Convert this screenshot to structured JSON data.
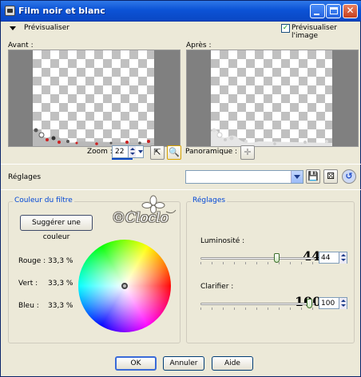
{
  "window": {
    "title": "Film noir et blanc"
  },
  "preview": {
    "toggle_label": "Prévisualiser",
    "show_image_label": "Prévisualiser l'image",
    "show_image_checked": true,
    "before_label": "Avant :",
    "after_label": "Après :"
  },
  "zoom": {
    "label": "Zoom :",
    "value": "22"
  },
  "pan": {
    "label": "Panoramique :"
  },
  "presets": {
    "label": "Réglages",
    "value": ""
  },
  "filter_group": {
    "title": "Couleur du filtre",
    "suggest_label": "Suggérer une couleur",
    "rows": [
      {
        "label": "Rouge :",
        "value": "33,3 %"
      },
      {
        "label": "Vert :",
        "value": "33,3 %"
      },
      {
        "label": "Bleu :",
        "value": "33,3 %"
      }
    ]
  },
  "settings_group": {
    "title": "Réglages",
    "luminosity": {
      "label": "Luminosité :",
      "value": "44",
      "annotation": "44"
    },
    "clarify": {
      "label": "Clarifier :",
      "value": "100",
      "annotation": "100"
    }
  },
  "watermark": {
    "text": "©Cloclo"
  },
  "buttons": {
    "ok": "OK",
    "cancel": "Annuler",
    "help": "Aide"
  }
}
